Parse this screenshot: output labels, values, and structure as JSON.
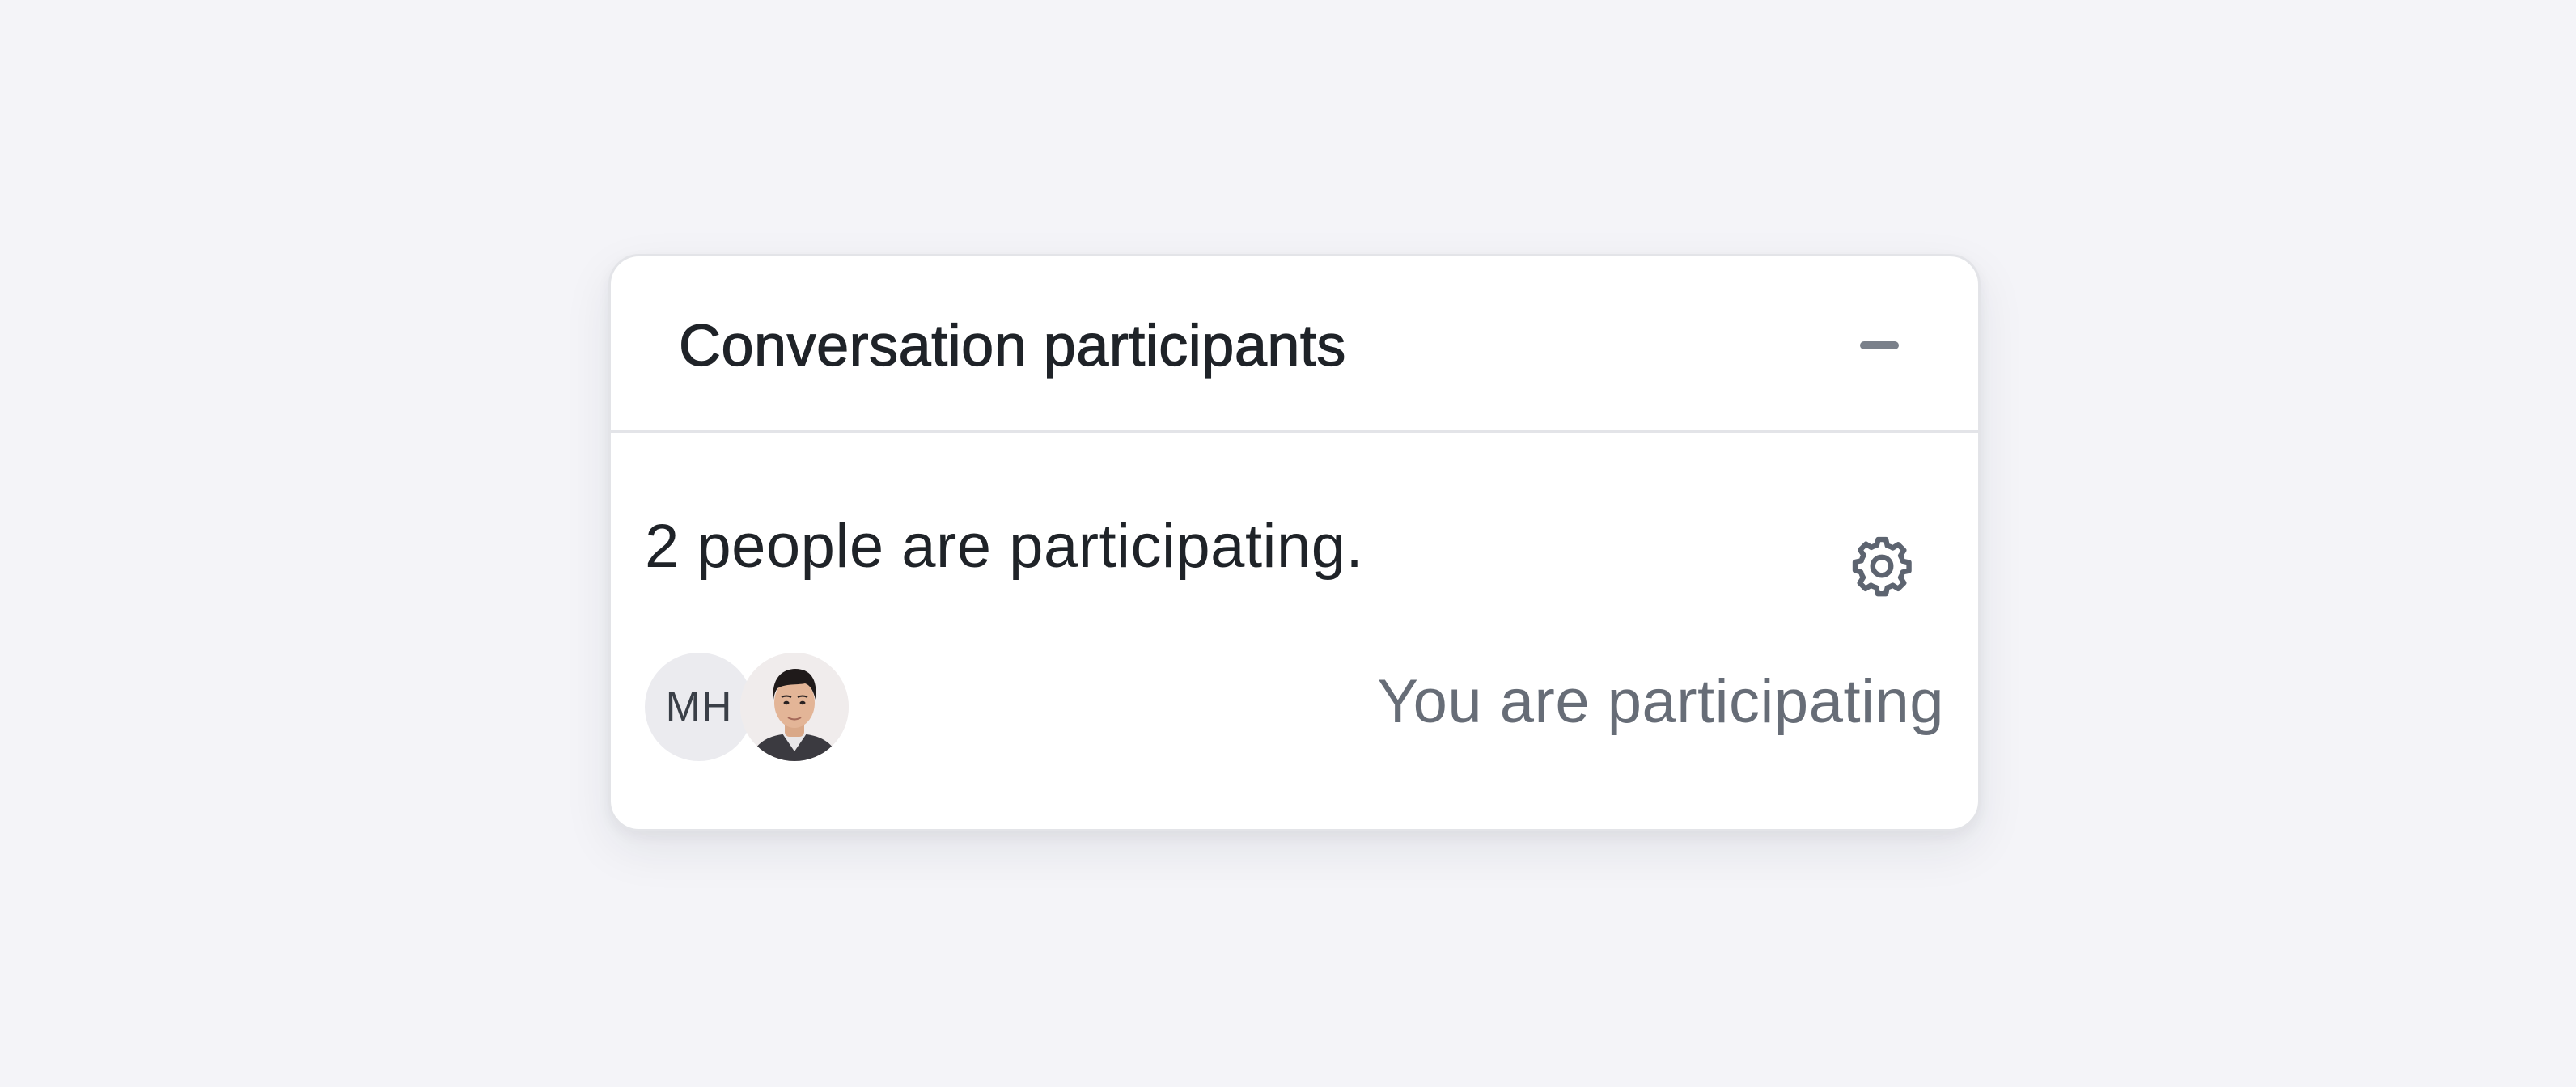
{
  "panel": {
    "title": "Conversation participants",
    "collapse_icon": "minus-icon",
    "participant_count_text": "2 people are participating.",
    "settings_icon": "gear-icon",
    "participants": [
      {
        "initials": "MH",
        "type": "initials"
      },
      {
        "type": "photo"
      }
    ],
    "status_text": "You are participating"
  },
  "colors": {
    "background": "#f4f4f8",
    "card": "#ffffff",
    "border": "#e3e4e8",
    "text_primary": "#1f2328",
    "text_secondary": "#676d77",
    "icon": "#5d6470"
  }
}
